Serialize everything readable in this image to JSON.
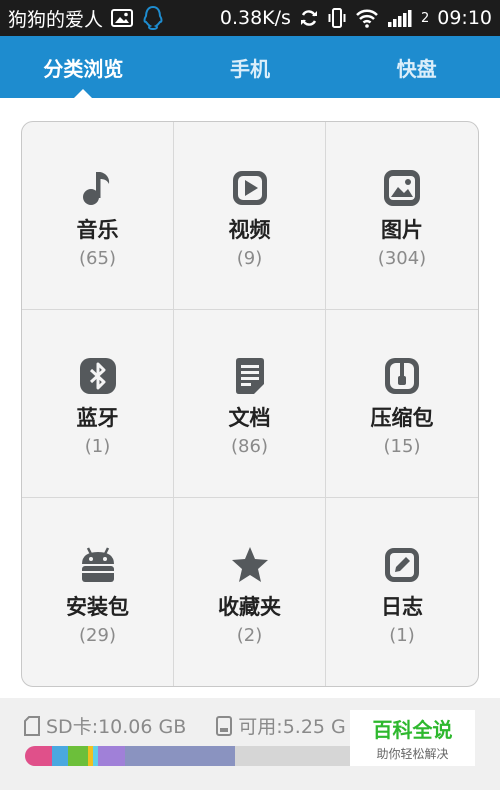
{
  "status_bar": {
    "title": "狗狗的爱人",
    "speed": "0.38K/s",
    "sim_number": "2",
    "time": "09:10",
    "icons": [
      "image-icon",
      "qq-icon",
      "sync-icon",
      "vibrate-icon",
      "wifi-icon",
      "signal-icon"
    ]
  },
  "tabs": [
    {
      "label": "分类浏览",
      "active": true
    },
    {
      "label": "手机",
      "active": false
    },
    {
      "label": "快盘",
      "active": false
    }
  ],
  "categories": [
    {
      "name": "音乐",
      "count": "(65)",
      "icon": "music-icon"
    },
    {
      "name": "视频",
      "count": "(9)",
      "icon": "video-icon"
    },
    {
      "name": "图片",
      "count": "(304)",
      "icon": "image-icon"
    },
    {
      "name": "蓝牙",
      "count": "(1)",
      "icon": "bluetooth-icon"
    },
    {
      "name": "文档",
      "count": "(86)",
      "icon": "document-icon"
    },
    {
      "name": "压缩包",
      "count": "(15)",
      "icon": "zip-icon"
    },
    {
      "name": "安装包",
      "count": "(29)",
      "icon": "android-icon"
    },
    {
      "name": "收藏夹",
      "count": "(2)",
      "icon": "star-icon"
    },
    {
      "name": "日志",
      "count": "(1)",
      "icon": "edit-icon"
    }
  ],
  "storage": {
    "sd_label": "SD卡:10.06 GB",
    "free_label": "可用:5.25 G",
    "segments": [
      {
        "color": "#e0508a",
        "fraction": 0.06
      },
      {
        "color": "#4aa8e0",
        "fraction": 0.035
      },
      {
        "color": "#6cbf3a",
        "fraction": 0.045
      },
      {
        "color": "#f0c020",
        "fraction": 0.01
      },
      {
        "color": "#5fd0e8",
        "fraction": 0.012
      },
      {
        "color": "#a080d8",
        "fraction": 0.06
      },
      {
        "color": "#8a93c0",
        "fraction": 0.245
      }
    ]
  },
  "watermark": {
    "title": "百科全说",
    "subtitle": "助你轻松解决"
  },
  "colors": {
    "accent": "#1e8ccf",
    "icon": "#55595c"
  }
}
